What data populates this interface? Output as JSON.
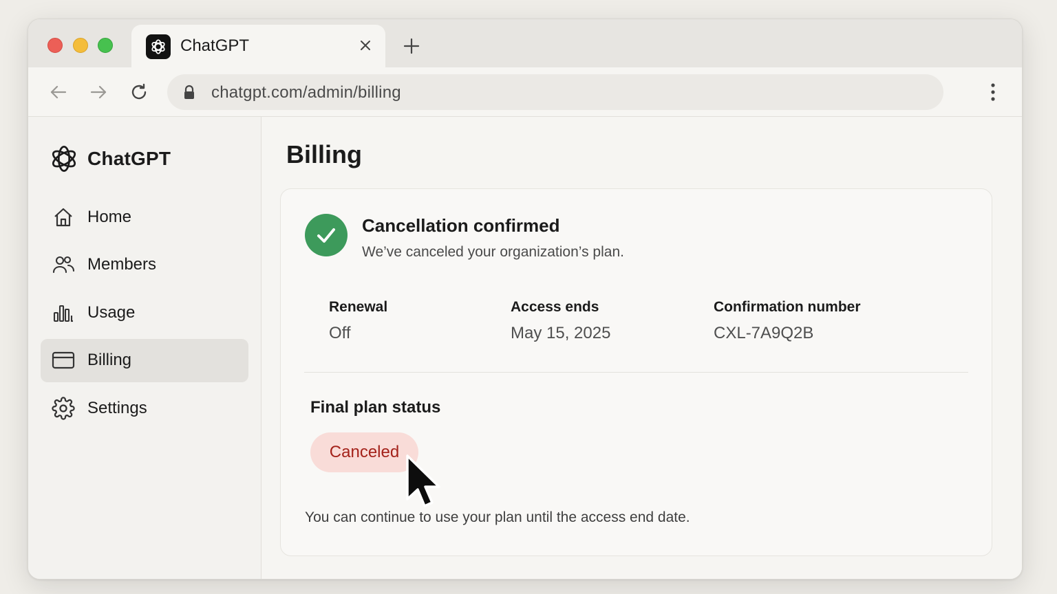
{
  "browser": {
    "tab_title": "ChatGPT",
    "url": "chatgpt.com/admin/billing"
  },
  "sidebar": {
    "brand": "ChatGPT",
    "items": [
      {
        "label": "Home",
        "icon": "home-icon"
      },
      {
        "label": "Members",
        "icon": "members-icon"
      },
      {
        "label": "Usage",
        "icon": "usage-icon"
      },
      {
        "label": "Billing",
        "icon": "billing-icon",
        "active": true
      },
      {
        "label": "Settings",
        "icon": "gear-icon"
      }
    ]
  },
  "main": {
    "title": "Billing",
    "confirmation": {
      "title": "Cancellation confirmed",
      "subtitle": "We’ve canceled your organization’s plan."
    },
    "details": {
      "renewal": {
        "label": "Renewal",
        "value": "Off"
      },
      "access_ends": {
        "label": "Access ends",
        "value": "May 15, 2025"
      },
      "confirmation_number": {
        "label": "Confirmation number",
        "value": "CXL-7A9Q2B"
      }
    },
    "final_status": {
      "label": "Final plan status",
      "value": "Canceled"
    },
    "footnote": "You can continue to use your plan until the access end date."
  },
  "colors": {
    "success": "#3d9a5b",
    "status_bg": "#f9dcd8",
    "status_text": "#a4221a"
  }
}
